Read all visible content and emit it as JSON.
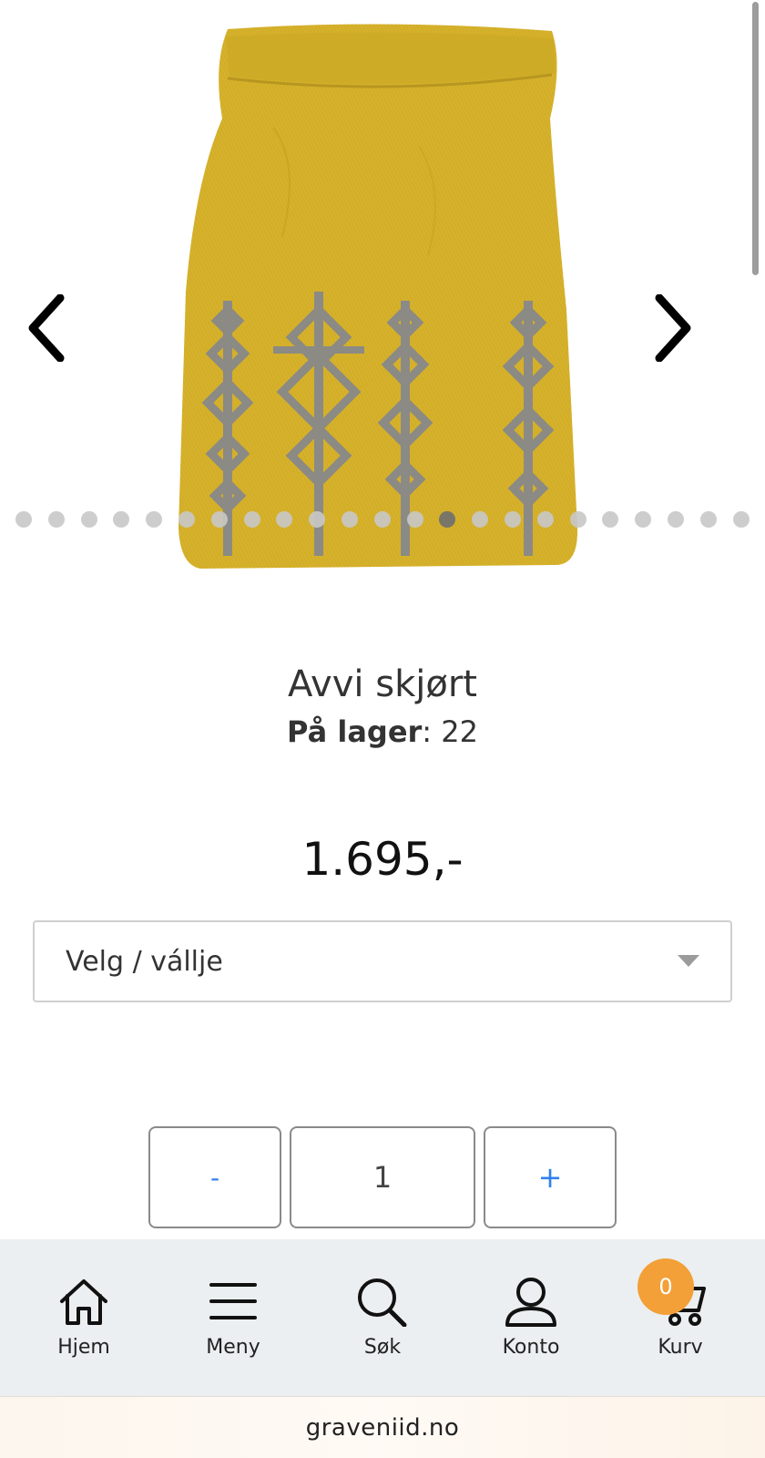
{
  "gallery": {
    "image_alt": "yellow knitted skirt with grey pattern",
    "prev_icon": "chevron-left-icon",
    "next_icon": "chevron-right-icon",
    "dot_count": 23,
    "active_dot": 13
  },
  "product": {
    "title": "Avvi skjørt",
    "stock_label": "På lager",
    "stock_value": ": 22",
    "price": "1.695,-"
  },
  "variant_select": {
    "value": "Velg / vállje",
    "icon": "caret-down-icon"
  },
  "quantity": {
    "minus_label": "-",
    "value": "1",
    "plus_label": "+"
  },
  "bottom_nav": {
    "items": [
      {
        "label": "Hjem",
        "icon": "home-icon"
      },
      {
        "label": "Meny",
        "icon": "menu-icon"
      },
      {
        "label": "Søk",
        "icon": "search-icon"
      },
      {
        "label": "Konto",
        "icon": "user-icon"
      },
      {
        "label": "Kurv",
        "icon": "cart-icon"
      }
    ],
    "cart_count": "0"
  },
  "browser": {
    "url": "graveniid.no"
  },
  "colors": {
    "accent_blue": "#2f80ed",
    "badge_orange": "#f2a037",
    "product_yellow": "#d9b42a",
    "pattern_grey": "#8a8a86",
    "nav_bg": "#eceff1"
  }
}
